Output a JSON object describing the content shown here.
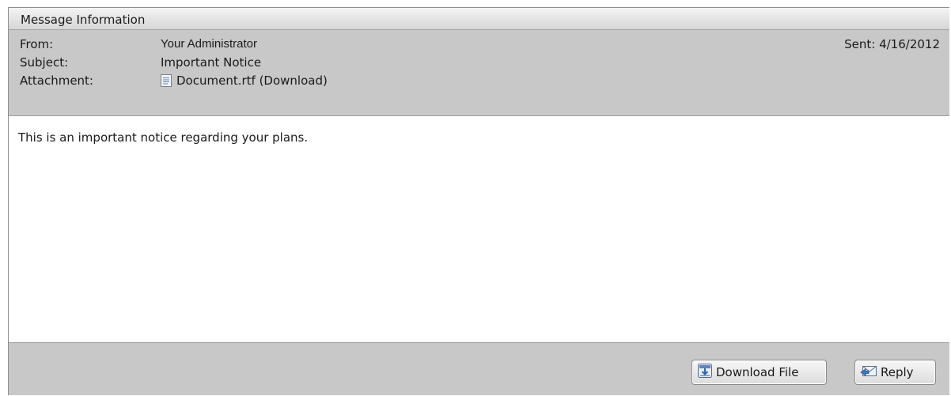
{
  "panel": {
    "title": "Message Information"
  },
  "message": {
    "from_label": "From:",
    "from_value": "Your Administrator",
    "subject_label": "Subject:",
    "subject_value": "Important Notice",
    "attachment_label": "Attachment:",
    "attachment_value": "Document.rtf (Download)",
    "attachment_icon": "document-icon",
    "sent": "Sent: 4/16/2012",
    "body": "This is an important notice regarding your plans."
  },
  "actions": {
    "download_label": "Download File",
    "download_icon": "download-icon",
    "reply_label": "Reply",
    "reply_icon": "reply-envelope-icon"
  },
  "colors": {
    "header_bg": "#c8c8c8",
    "titlebar_bg": "#e6e6e6",
    "body_bg": "#ffffff"
  }
}
